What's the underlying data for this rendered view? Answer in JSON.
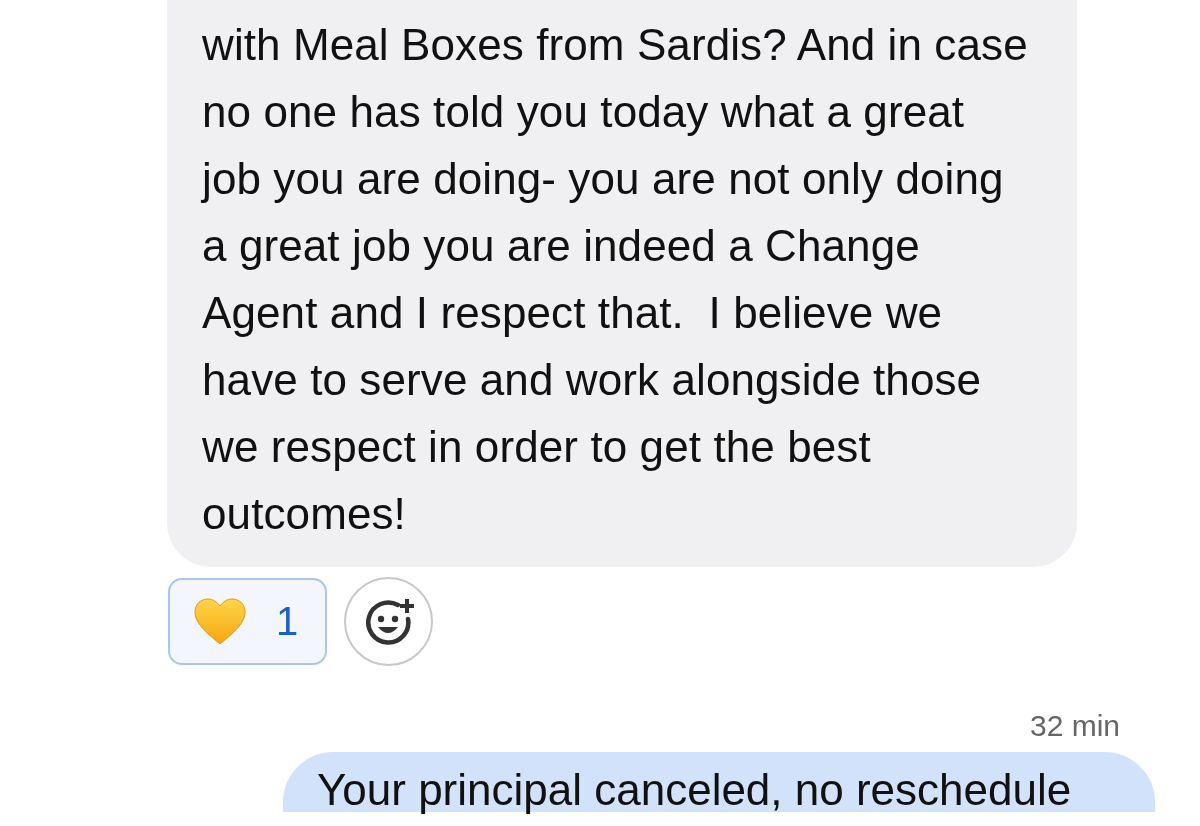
{
  "received_message": {
    "lines": [
      "with Meal Boxes from Sardis? And in case",
      "no one has told you today what a great",
      "job you are doing- you are not only doing",
      "a great job you are indeed a Change",
      "Agent and I respect that.  I believe we",
      "have to serve and work alongside those",
      "we respect in order to get the best",
      "outcomes!"
    ],
    "reactions": [
      {
        "kind": "heart",
        "count": "1",
        "selected": true
      },
      {
        "kind": "add"
      }
    ]
  },
  "sent_message": {
    "time": "32 min",
    "text": "Your principal canceled, no reschedule"
  }
}
